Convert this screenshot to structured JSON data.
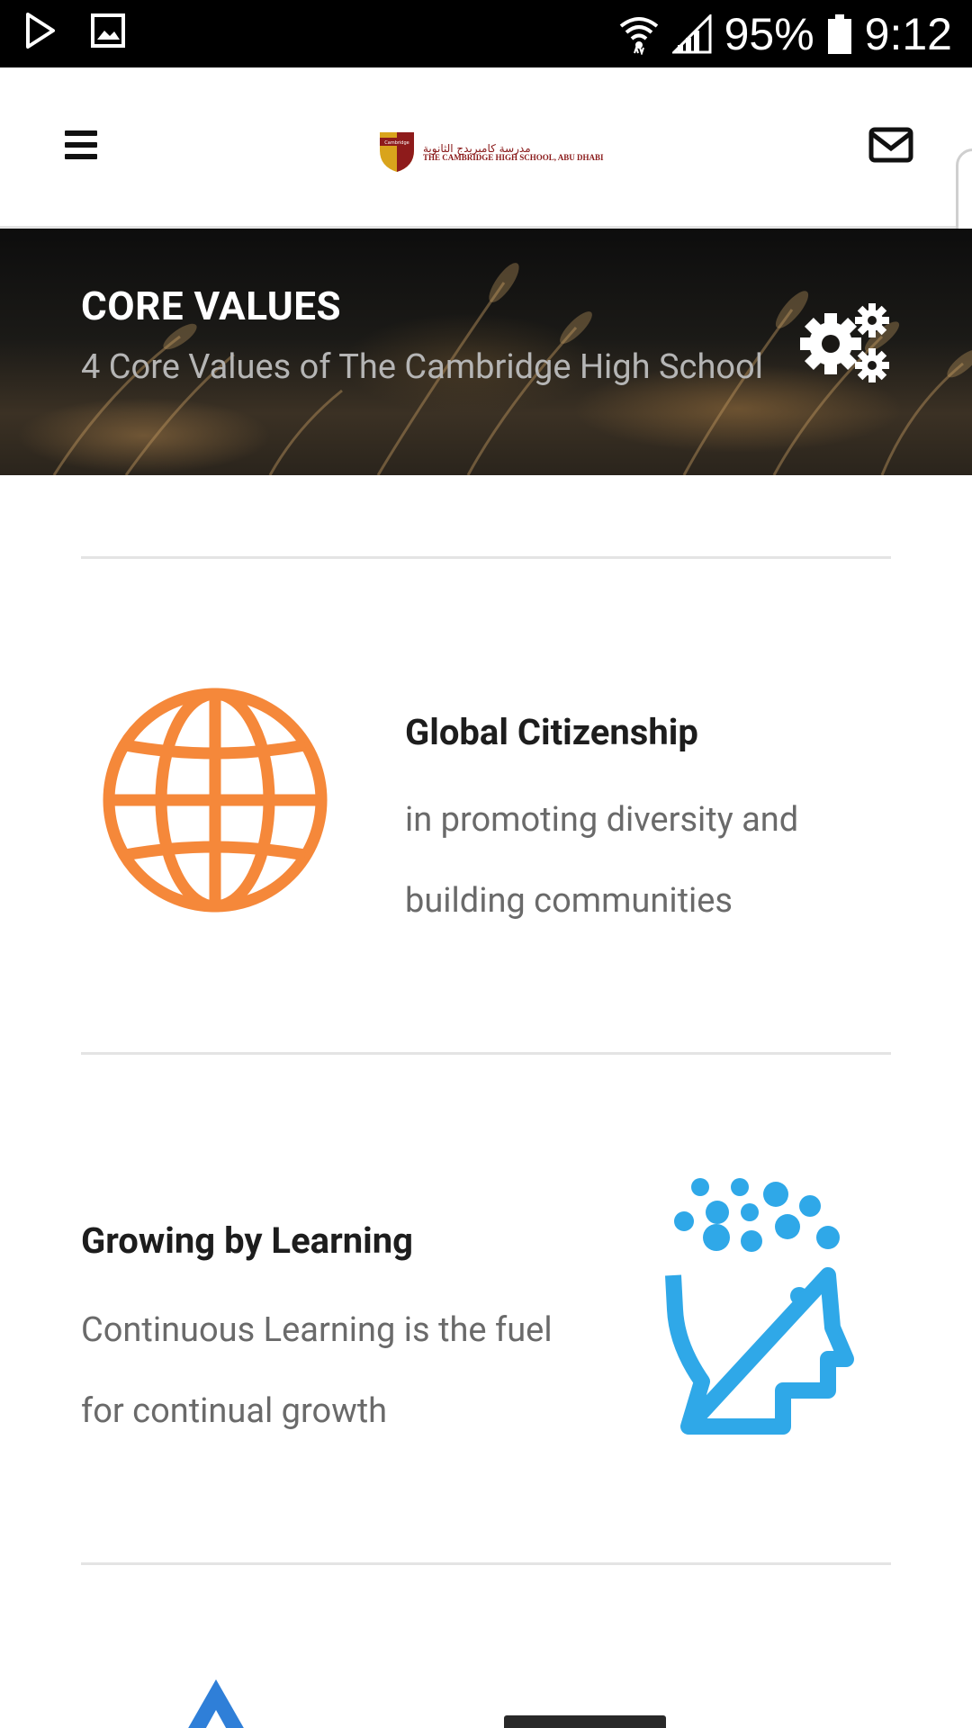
{
  "status_bar": {
    "battery": "95%",
    "time": "9:12",
    "icons": [
      "play-store-icon",
      "gallery-icon",
      "wifi-icon",
      "signal-icon",
      "battery-icon"
    ]
  },
  "header": {
    "logo_arabic": "مدرسة كامبريدج الثانوية",
    "logo_english": "THE CAMBRIDGE HIGH SCHOOL, ABU DHABI",
    "logo_crest_text": "Cambridge"
  },
  "banner": {
    "title": "CORE VALUES",
    "subtitle": "4 Core Values of The Cambridge High School"
  },
  "values": [
    {
      "title": "Global Citizenship",
      "description": "in promoting diversity and building communities",
      "icon": "globe-icon",
      "color": "#f5883a"
    },
    {
      "title": "Growing by Learning",
      "description": "Continuous Learning is the fuel for continual growth",
      "icon": "learning-head-icon",
      "color": "#2fa8e8"
    },
    {
      "title": "",
      "icon": "aspire-icon",
      "color": "#2f7fd8"
    }
  ]
}
